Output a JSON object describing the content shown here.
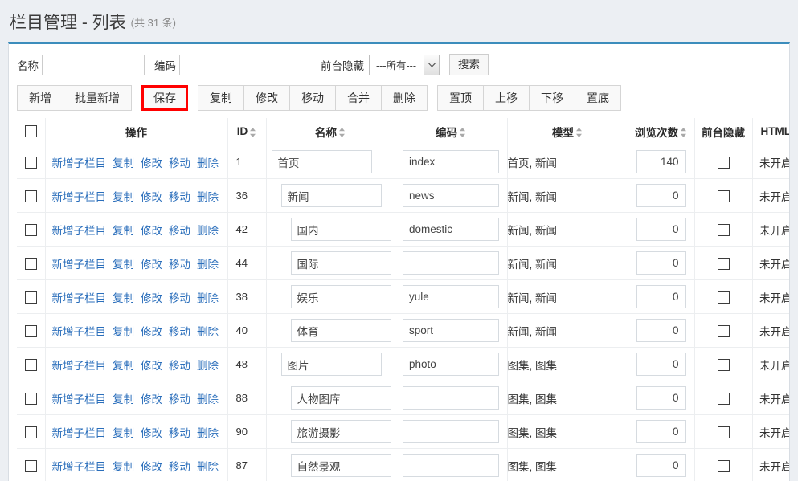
{
  "header": {
    "title": "栏目管理 - 列表",
    "count_text": "(共 31 条)"
  },
  "search": {
    "name_label": "名称",
    "name_value": "",
    "code_label": "编码",
    "code_value": "",
    "hidden_label": "前台隐藏",
    "hidden_selected": "---所有---",
    "hidden_options": [
      "---所有---"
    ],
    "search_button": "搜索"
  },
  "toolbar": {
    "groups": [
      {
        "buttons": [
          {
            "label": "新增",
            "highlighted": false
          },
          {
            "label": "批量新增",
            "highlighted": false
          }
        ]
      },
      {
        "buttons": [
          {
            "label": "保存",
            "highlighted": true
          }
        ]
      },
      {
        "buttons": [
          {
            "label": "复制",
            "highlighted": false
          },
          {
            "label": "修改",
            "highlighted": false
          },
          {
            "label": "移动",
            "highlighted": false
          },
          {
            "label": "合并",
            "highlighted": false
          },
          {
            "label": "删除",
            "highlighted": false
          }
        ]
      },
      {
        "buttons": [
          {
            "label": "置顶",
            "highlighted": false
          },
          {
            "label": "上移",
            "highlighted": false
          },
          {
            "label": "下移",
            "highlighted": false
          },
          {
            "label": "置底",
            "highlighted": false
          }
        ]
      }
    ]
  },
  "table": {
    "columns": [
      {
        "key": "select",
        "label": "",
        "sortable": false
      },
      {
        "key": "ops",
        "label": "操作",
        "sortable": false
      },
      {
        "key": "id",
        "label": "ID",
        "sortable": true
      },
      {
        "key": "name",
        "label": "名称",
        "sortable": true
      },
      {
        "key": "code",
        "label": "编码",
        "sortable": true
      },
      {
        "key": "model",
        "label": "模型",
        "sortable": true
      },
      {
        "key": "views",
        "label": "浏览次数",
        "sortable": true
      },
      {
        "key": "hidden",
        "label": "前台隐藏",
        "sortable": false
      },
      {
        "key": "html",
        "label": "HTML",
        "sortable": false
      }
    ],
    "row_ops": [
      "新增子栏目",
      "复制",
      "修改",
      "移动",
      "删除"
    ],
    "rows": [
      {
        "id": "1",
        "name": "首页",
        "indent": 0,
        "code": "index",
        "model": "首页, 新闻",
        "views": "140",
        "hidden": false,
        "html": "未开启"
      },
      {
        "id": "36",
        "name": "新闻",
        "indent": 1,
        "code": "news",
        "model": "新闻, 新闻",
        "views": "0",
        "hidden": false,
        "html": "未开启"
      },
      {
        "id": "42",
        "name": "国内",
        "indent": 2,
        "code": "domestic",
        "model": "新闻, 新闻",
        "views": "0",
        "hidden": false,
        "html": "未开启"
      },
      {
        "id": "44",
        "name": "国际",
        "indent": 2,
        "code": "",
        "model": "新闻, 新闻",
        "views": "0",
        "hidden": false,
        "html": "未开启"
      },
      {
        "id": "38",
        "name": "娱乐",
        "indent": 2,
        "code": "yule",
        "model": "新闻, 新闻",
        "views": "0",
        "hidden": false,
        "html": "未开启"
      },
      {
        "id": "40",
        "name": "体育",
        "indent": 2,
        "code": "sport",
        "model": "新闻, 新闻",
        "views": "0",
        "hidden": false,
        "html": "未开启"
      },
      {
        "id": "48",
        "name": "图片",
        "indent": 1,
        "code": "photo",
        "model": "图集, 图集",
        "views": "0",
        "hidden": false,
        "html": "未开启"
      },
      {
        "id": "88",
        "name": "人物图库",
        "indent": 2,
        "code": "",
        "model": "图集, 图集",
        "views": "0",
        "hidden": false,
        "html": "未开启"
      },
      {
        "id": "90",
        "name": "旅游摄影",
        "indent": 2,
        "code": "",
        "model": "图集, 图集",
        "views": "0",
        "hidden": false,
        "html": "未开启"
      },
      {
        "id": "87",
        "name": "自然景观",
        "indent": 2,
        "code": "",
        "model": "图集, 图集",
        "views": "0",
        "hidden": false,
        "html": "未开启"
      }
    ]
  },
  "colors": {
    "accent_bar": "#3c8dbc",
    "link": "#2a6ebb",
    "highlight_border": "#ff0000",
    "page_bg": "#eceff3"
  }
}
